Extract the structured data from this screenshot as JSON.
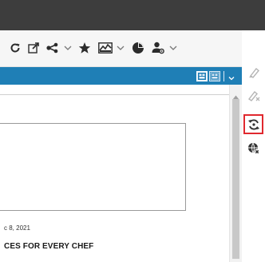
{
  "article": {
    "date": "c 8, 2021",
    "headline": "CES FOR EVERY CHEF"
  },
  "toolbar": {
    "icons": [
      "refresh-icon",
      "open-external-icon",
      "share-icon",
      "favorite-star-icon",
      "analytics-icon",
      "pie-chart-icon",
      "user-settings-icon"
    ]
  },
  "view_controls": {
    "icons": [
      "layout-view-icon",
      "grid-view-icon"
    ]
  },
  "sidebar": {
    "icons": [
      "highlighter-icon",
      "eraser-icon",
      "sync-icon",
      "globe-off-icon"
    ],
    "selected": "sync-icon",
    "selected_color": "#e0282e"
  },
  "colors": {
    "header_blue": "#1f7fb6",
    "topbar": "#3d3d3d",
    "icon": "#2b2b2b"
  }
}
